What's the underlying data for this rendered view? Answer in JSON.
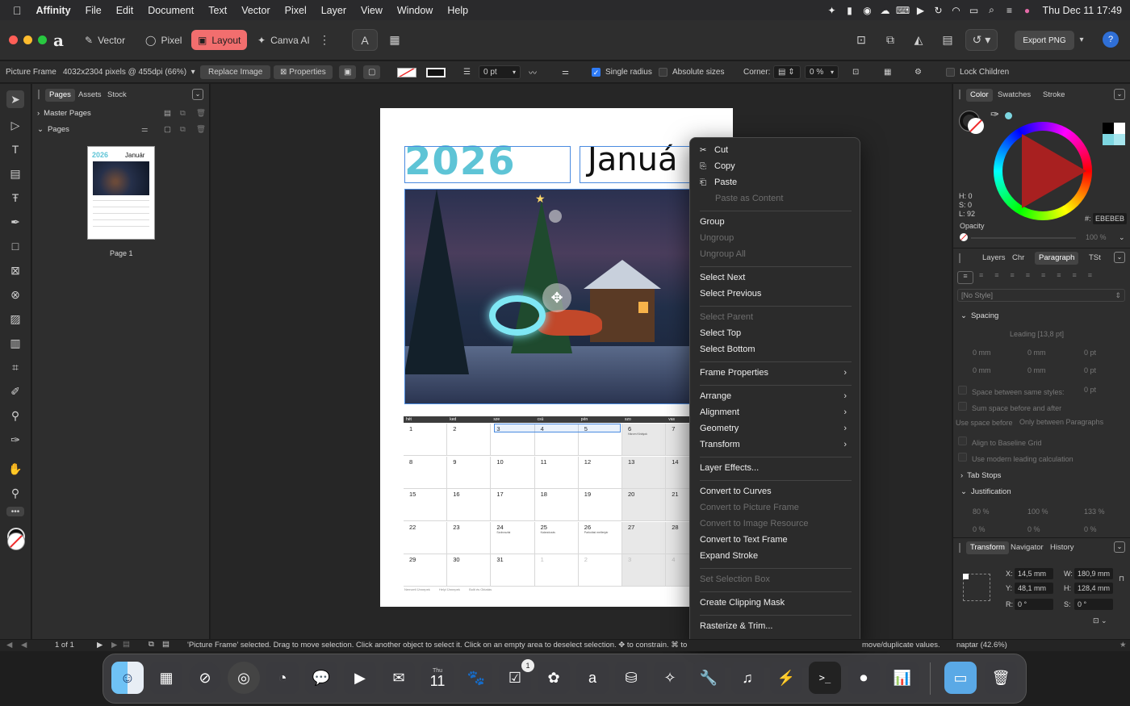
{
  "menubar": {
    "apple": "",
    "app": "Affinity",
    "items": [
      "File",
      "Edit",
      "Document",
      "Text",
      "Vector",
      "Pixel",
      "Layer",
      "View",
      "Window",
      "Help"
    ],
    "clock": "Thu Dec 11  17:49"
  },
  "toolbar": {
    "personas": [
      {
        "label": "Vector",
        "icon": "vector-persona-icon",
        "glyph": "✎"
      },
      {
        "label": "Pixel",
        "icon": "pixel-persona-icon",
        "glyph": "◯"
      },
      {
        "label": "Layout",
        "icon": "layout-persona-icon",
        "glyph": "▣"
      },
      {
        "label": "Canva AI",
        "icon": "canva-ai-icon",
        "glyph": "✦"
      }
    ],
    "export_label": "Export PNG",
    "help_glyph": "?"
  },
  "context_toolbar": {
    "object_type": "Picture Frame",
    "image_info": "4032x2304 pixels @ 455dpi (66%)",
    "replace_image": "Replace Image",
    "properties": "Properties",
    "stroke_width": "0 pt",
    "single_radius": "Single radius",
    "absolute_sizes": "Absolute sizes",
    "corner_label": "Corner:",
    "corner_value": "0 %",
    "lock_children": "Lock Children"
  },
  "pages_panel": {
    "tabs": [
      "Pages",
      "Assets",
      "Stock"
    ],
    "master_pages": "Master Pages",
    "pages": "Pages",
    "page_label": "Page 1",
    "thumb_year": "2026",
    "thumb_month": "Január"
  },
  "page": {
    "year": "2026",
    "month": "Januá",
    "day_headers": [
      "hét",
      "ked",
      "sze",
      "csü",
      "pén",
      "szo",
      "vas"
    ],
    "weeks": [
      [
        "1",
        "2",
        "3",
        "4",
        "5",
        "6",
        "7"
      ],
      [
        "8",
        "9",
        "10",
        "11",
        "12",
        "13",
        "14"
      ],
      [
        "15",
        "16",
        "17",
        "18",
        "19",
        "20",
        "21"
      ],
      [
        "22",
        "23",
        "24",
        "25",
        "26",
        "27",
        "28"
      ],
      [
        "29",
        "30",
        "31",
        "1",
        "2",
        "3",
        "4"
      ]
    ],
    "notes": {
      "6": "Három Királyok",
      "24": "Szoboszlai",
      "25": "Kalandozás",
      "26": "Parkolási mellenjár",
      "31": "Szilveszter"
    },
    "legend": [
      "Nemzeti Ünnepek",
      "Helyi Ünnepek",
      "Bolti és Oktatás"
    ]
  },
  "context_menu": {
    "items": [
      {
        "label": "Cut",
        "icon": "✂",
        "disabled": false
      },
      {
        "label": "Copy",
        "icon": "⎘",
        "disabled": false
      },
      {
        "label": "Paste",
        "icon": "⎗",
        "disabled": false
      },
      {
        "label": "Paste as Content",
        "disabled": true
      },
      {
        "sep": true
      },
      {
        "label": "Group",
        "disabled": false
      },
      {
        "label": "Ungroup",
        "disabled": true
      },
      {
        "label": "Ungroup All",
        "disabled": true
      },
      {
        "sep": true
      },
      {
        "label": "Select Next",
        "disabled": false
      },
      {
        "label": "Select Previous",
        "disabled": false
      },
      {
        "sep": true
      },
      {
        "label": "Select Parent",
        "disabled": true
      },
      {
        "label": "Select Top",
        "disabled": false
      },
      {
        "label": "Select Bottom",
        "disabled": false
      },
      {
        "sep": true
      },
      {
        "label": "Frame Properties",
        "disabled": false,
        "submenu": true
      },
      {
        "sep": true
      },
      {
        "label": "Arrange",
        "disabled": false,
        "submenu": true
      },
      {
        "label": "Alignment",
        "disabled": false,
        "submenu": true
      },
      {
        "label": "Geometry",
        "disabled": false,
        "submenu": true
      },
      {
        "label": "Transform",
        "disabled": false,
        "submenu": true
      },
      {
        "sep": true
      },
      {
        "label": "Layer Effects...",
        "disabled": false
      },
      {
        "sep": true
      },
      {
        "label": "Convert to Curves",
        "disabled": false
      },
      {
        "label": "Convert to Picture Frame",
        "disabled": true
      },
      {
        "label": "Convert to Image Resource",
        "disabled": true
      },
      {
        "label": "Convert to Text Frame",
        "disabled": false
      },
      {
        "label": "Expand Stroke",
        "disabled": false
      },
      {
        "sep": true
      },
      {
        "label": "Set Selection Box",
        "disabled": true
      },
      {
        "sep": true
      },
      {
        "label": "Create Clipping Mask",
        "disabled": false
      },
      {
        "sep": true
      },
      {
        "label": "Rasterize & Trim...",
        "disabled": false
      }
    ],
    "more_arrow": "⌄"
  },
  "right_panel": {
    "color_tabs": [
      "Color",
      "Swatches",
      "Stroke"
    ],
    "hsl": [
      "H: 0",
      "S: 0",
      "L: 92"
    ],
    "hex_label": "#:",
    "hex": "EBEBEB",
    "opacity_label": "Opacity",
    "opacity": "100 %",
    "mid_tabs": [
      "Layers",
      "Chr",
      "Paragraph",
      "TSt"
    ],
    "style": "[No Style]",
    "spacing": "Spacing",
    "leading": "Leading  [13,8 pt]",
    "mm0": "0 mm",
    "pt0": "0 pt",
    "space_same": "Space between same styles:",
    "sum_space": "Sum space before and after",
    "use_space_before": "Use space before",
    "only_between": "Only between Paragraphs",
    "align_baseline": "Align to Baseline Grid",
    "modern_leading": "Use modern leading calculation",
    "tab_stops": "Tab Stops",
    "justification": "Justification",
    "j80": "80 %",
    "j100": "100 %",
    "j133": "133 %",
    "p0": "0 %",
    "bottom_tabs": [
      "Transform",
      "Navigator",
      "History"
    ],
    "x_label": "X:",
    "x": "14,5 mm",
    "y_label": "Y:",
    "y": "48,1 mm",
    "w_label": "W:",
    "w": "180,9 mm",
    "h_label": "H:",
    "h": "128,4 mm",
    "r_label": "R:",
    "r": "0 °",
    "s_label": "S:",
    "s": "0 °",
    "doc_name": "naptar (42.6%)"
  },
  "status": {
    "page_count": "1 of 1",
    "message": "'Picture Frame' selected. Drag to move selection. Click another object to select it. Click on an empty area to deselect selection. ✥ to constrain. ⌘ to clone.",
    "message_tail": "move/duplicate values."
  },
  "dock": {
    "badge": "1",
    "calendar_day": "11",
    "calendar_month": "Thu"
  },
  "colors": {
    "accent": "#f26e6e",
    "year_cyan": "#5ec4d6",
    "selection_blue": "#4a8be0"
  }
}
